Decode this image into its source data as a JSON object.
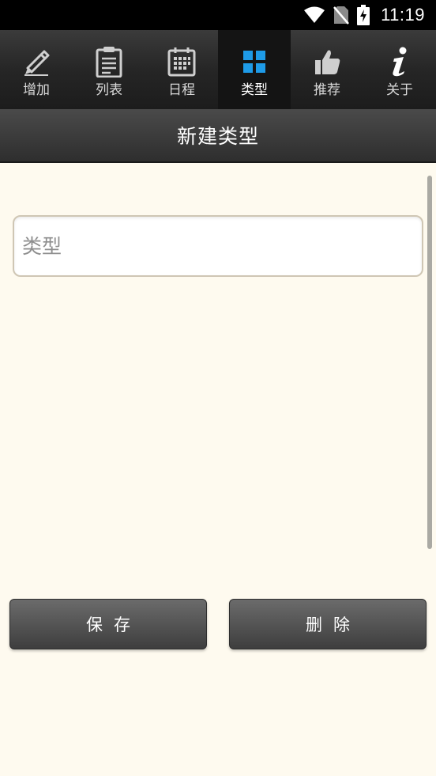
{
  "status_bar": {
    "time": "11:19",
    "icons": [
      "wifi-icon",
      "no-sim-icon",
      "battery-charging-icon"
    ]
  },
  "tabs": [
    {
      "label": "增加",
      "icon": "pencil-icon",
      "active": false
    },
    {
      "label": "列表",
      "icon": "clipboard-list-icon",
      "active": false
    },
    {
      "label": "日程",
      "icon": "calendar-icon",
      "active": false
    },
    {
      "label": "类型",
      "icon": "grid-icon",
      "active": true
    },
    {
      "label": "推荐",
      "icon": "thumbs-up-icon",
      "active": false
    },
    {
      "label": "关于",
      "icon": "info-icon",
      "active": false
    }
  ],
  "header": {
    "title": "新建类型"
  },
  "form": {
    "type_value": "",
    "type_placeholder": "类型"
  },
  "buttons": {
    "save_label": "保存",
    "delete_label": "删除"
  },
  "colors": {
    "background": "#fefaef",
    "active_tab_icon": "#1e9be8",
    "tab_bar": "#262626",
    "button": "#555555"
  }
}
